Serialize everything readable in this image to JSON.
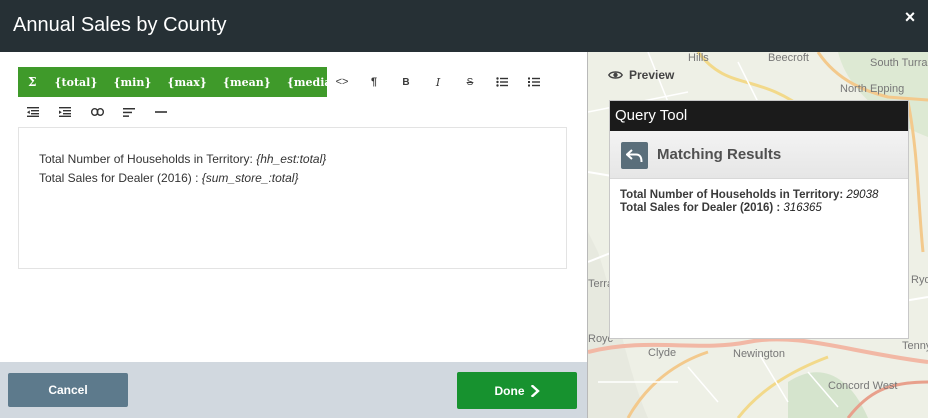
{
  "window": {
    "title": "Annual Sales by County",
    "close_icon": "×"
  },
  "editor_toolbar": {
    "green_buttons": [
      {
        "label": "Σ"
      },
      {
        "label": "{total}"
      },
      {
        "label": "{min}"
      },
      {
        "label": "{max}"
      },
      {
        "label": "{mean}"
      },
      {
        "label": "{median}"
      }
    ],
    "icons": [
      {
        "name": "code-icon",
        "glyph": "<>"
      },
      {
        "name": "paragraph-icon",
        "glyph": "¶"
      },
      {
        "name": "bold-icon",
        "glyph": "B"
      },
      {
        "name": "italic-icon",
        "glyph": "I"
      },
      {
        "name": "strikethrough-icon",
        "glyph": "S"
      },
      {
        "name": "bullet-list-icon"
      },
      {
        "name": "numbered-list-icon"
      },
      {
        "name": "outdent-icon"
      },
      {
        "name": "indent-icon"
      },
      {
        "name": "link-icon"
      },
      {
        "name": "align-left-icon"
      },
      {
        "name": "horizontal-rule-icon"
      }
    ]
  },
  "editor": {
    "line1_label": "Total Number of Households in Territory: ",
    "line1_token": "{hh_est:total}",
    "line2_label": "Total Sales for Dealer (2016) : ",
    "line2_token": "{sum_store_:total}"
  },
  "footer": {
    "cancel_label": "Cancel",
    "done_label": "Done"
  },
  "preview": {
    "label": "Preview",
    "map_labels": [
      "Hills",
      "Beecroft",
      "South Turra",
      "North Epping",
      "Clyde",
      "Newington",
      "Concord West",
      "Ryd",
      "Tenny",
      "Terra",
      "Royc"
    ],
    "query_tool": {
      "title": "Query Tool",
      "subtitle": "Matching Results",
      "line1_label": "Total Number of Households in Territory: ",
      "line1_value": "29038",
      "line2_label": "Total Sales for Dealer (2016) : ",
      "line2_value": "316365"
    }
  },
  "colors": {
    "header": "#263035",
    "green_toolbar": "#3f9a2a",
    "done_button": "#17922f",
    "cancel_button": "#5d7a8c",
    "footer_bg": "#d1d8df"
  }
}
